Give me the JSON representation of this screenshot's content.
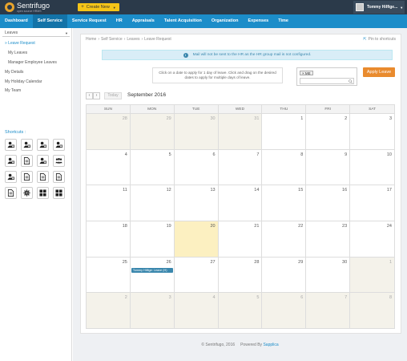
{
  "header": {
    "logo_name": "Sentrifugo",
    "logo_tagline": "open source HRMS",
    "create_label": "Create New",
    "user_name": "Tommy Hilfige..."
  },
  "nav": [
    "Dashboard",
    "Self Service",
    "Service Request",
    "HR",
    "Appraisals",
    "Talent Acquisition",
    "Organization",
    "Expenses",
    "Time"
  ],
  "nav_active": "Self Service",
  "sidebar": {
    "select_label": "Leaves",
    "links": [
      "Leave Request",
      "My Leaves",
      "Manager Employee Leaves",
      "My Details",
      "My Holiday Calendar",
      "My Team"
    ],
    "shortcuts_label": "Shortcuts :",
    "shortcut_icons": [
      "add-user-icon",
      "add-document-icon",
      "user-edit-icon",
      "user-clock-icon",
      "star-user-icon",
      "document-list-icon",
      "user-tag-icon",
      "group-icon",
      "user-check-icon",
      "document-check-icon",
      "document-copy-icon",
      "document-chart-icon",
      "document-edit-icon",
      "gear-icon",
      "grid-icon",
      "grid-icon"
    ]
  },
  "breadcrumb": [
    "Home",
    "Self Service",
    "Leaves",
    "Leave Request"
  ],
  "pin_label": "Pin to shortcuts",
  "info_message": "Mail will not be sent to the HR as the HR group mail is not configured.",
  "hint_text": "Click on a date to apply for 1 day of leave. Click and drag on the desired dates to apply for multiple days of leave.",
  "picker_tag": "× ME",
  "apply_label": "Apply Leave",
  "today_label": "Today",
  "month_title": "September 2016",
  "weekdays": [
    "SUN",
    "MON",
    "TUE",
    "WED",
    "THU",
    "FRI",
    "SAT"
  ],
  "weeks": [
    [
      {
        "d": "28",
        "o": true
      },
      {
        "d": "29",
        "o": true
      },
      {
        "d": "30",
        "o": true
      },
      {
        "d": "31",
        "o": true
      },
      {
        "d": "1"
      },
      {
        "d": "2"
      },
      {
        "d": "3"
      }
    ],
    [
      {
        "d": "4"
      },
      {
        "d": "5"
      },
      {
        "d": "6"
      },
      {
        "d": "7"
      },
      {
        "d": "8"
      },
      {
        "d": "9"
      },
      {
        "d": "10"
      }
    ],
    [
      {
        "d": "11"
      },
      {
        "d": "12"
      },
      {
        "d": "13"
      },
      {
        "d": "14"
      },
      {
        "d": "15"
      },
      {
        "d": "16"
      },
      {
        "d": "17"
      }
    ],
    [
      {
        "d": "18"
      },
      {
        "d": "19"
      },
      {
        "d": "20",
        "t": true
      },
      {
        "d": "21"
      },
      {
        "d": "22"
      },
      {
        "d": "23"
      },
      {
        "d": "24"
      }
    ],
    [
      {
        "d": "25"
      },
      {
        "d": "26",
        "e": "Tommy Hilfige: Leave (H)"
      },
      {
        "d": "27"
      },
      {
        "d": "28"
      },
      {
        "d": "29"
      },
      {
        "d": "30"
      },
      {
        "d": "1",
        "o": true
      }
    ],
    [
      {
        "d": "2",
        "o": true
      },
      {
        "d": "3",
        "o": true
      },
      {
        "d": "4",
        "o": true
      },
      {
        "d": "5",
        "o": true
      },
      {
        "d": "6",
        "o": true
      },
      {
        "d": "7",
        "o": true
      },
      {
        "d": "8",
        "o": true
      }
    ]
  ],
  "footer": {
    "copyright": "© Sentrifugo, 2016",
    "powered_label": "Powered By",
    "powered_link": "Sapplica"
  },
  "colors": {
    "topbar": "#2b3a4a",
    "nav": "#1c8dc9",
    "accent": "#e98b2e",
    "create": "#f5c518",
    "event": "#3a87ad"
  }
}
